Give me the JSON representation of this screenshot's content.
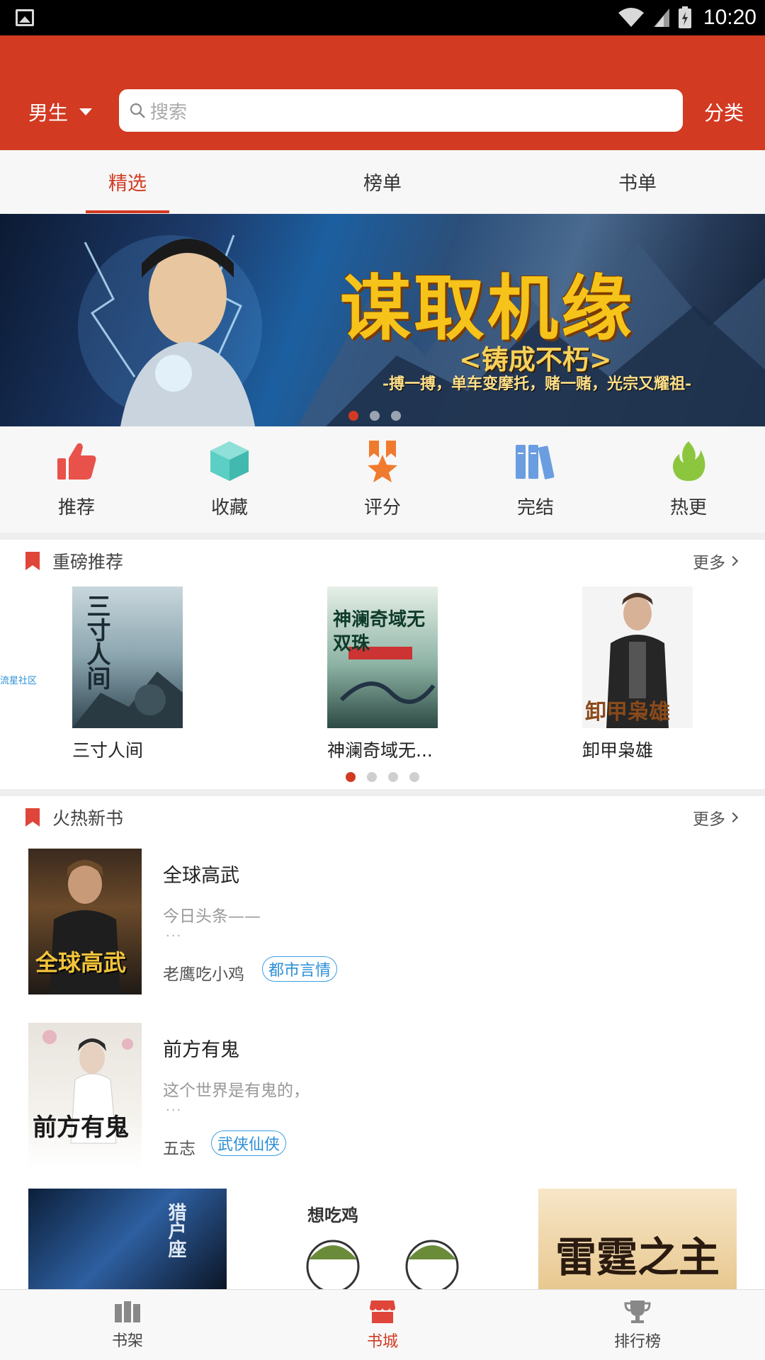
{
  "status_bar": {
    "time": "10:20"
  },
  "header": {
    "gender_label": "男生",
    "search_placeholder": "搜索",
    "category_label": "分类"
  },
  "tabs": [
    {
      "label": "精选",
      "active": true
    },
    {
      "label": "榜单",
      "active": false
    },
    {
      "label": "书单",
      "active": false
    }
  ],
  "banner": {
    "title": "谋取机缘",
    "subtitle": "<铸成不朽>",
    "tagline": "-搏一搏，单车变摩托，赌一赌，光宗又耀祖-",
    "page_count": 3,
    "active_page": 0
  },
  "quick_entries": [
    {
      "label": "推荐",
      "icon": "thumbs-up-icon",
      "color": "#e8524a"
    },
    {
      "label": "收藏",
      "icon": "cube-icon",
      "color": "#5ccfc4"
    },
    {
      "label": "评分",
      "icon": "medal-star-icon",
      "color": "#f07b2e"
    },
    {
      "label": "完结",
      "icon": "books-icon",
      "color": "#6a9ee0"
    },
    {
      "label": "热更",
      "icon": "flame-icon",
      "color": "#8cc63f"
    }
  ],
  "featured": {
    "section_title": "重磅推荐",
    "more_label": "更多",
    "side_link": "流星社区",
    "books": [
      {
        "name": "三寸人间",
        "cover_text": "三寸人间"
      },
      {
        "name": "神澜奇域无...",
        "cover_text": "神澜奇域无双珠"
      },
      {
        "name": "卸甲枭雄",
        "cover_text": "卸甲枭雄"
      }
    ],
    "page_count": 4,
    "active_page": 0
  },
  "hot_new": {
    "section_title": "火热新书",
    "more_label": "更多",
    "items": [
      {
        "title": "全球高武",
        "desc": "今日头条——",
        "ellipsis": "...",
        "author": "老鹰吃小鸡",
        "tag": "都市言情",
        "cover_text": "全球高武"
      },
      {
        "title": "前方有鬼",
        "desc": "这个世界是有鬼的，",
        "ellipsis": "...",
        "author": "五志",
        "tag": "武侠仙侠",
        "cover_text": "前方有鬼"
      }
    ]
  },
  "thumbs": [
    {
      "text": "猎户座"
    },
    {
      "text": "想吃鸡"
    },
    {
      "text": "雷霆之主"
    }
  ],
  "bottom_nav": [
    {
      "label": "书架",
      "icon": "bookshelf-icon",
      "active": false
    },
    {
      "label": "书城",
      "icon": "store-icon",
      "active": true
    },
    {
      "label": "排行榜",
      "icon": "trophy-icon",
      "active": false
    }
  ],
  "colors": {
    "primary": "#d23a22",
    "tag_blue": "#2b8fd6"
  }
}
